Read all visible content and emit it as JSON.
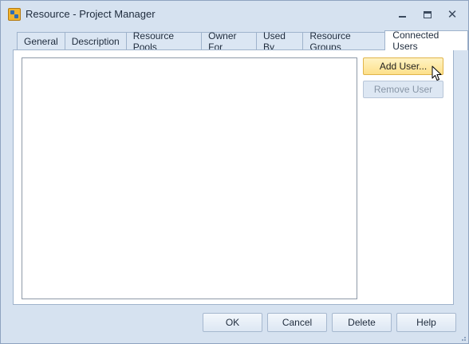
{
  "window": {
    "title": "Resource - Project Manager",
    "app_icon": "resource-app-icon",
    "controls": [
      "minimize-icon",
      "maximize-icon",
      "close-icon"
    ]
  },
  "tabs": [
    {
      "label": "General",
      "active": false
    },
    {
      "label": "Description",
      "active": false
    },
    {
      "label": "Resource Pools",
      "active": false
    },
    {
      "label": "Owner For",
      "active": false
    },
    {
      "label": "Used By",
      "active": false
    },
    {
      "label": "Resource Groups",
      "active": false
    },
    {
      "label": "Connected Users",
      "active": true
    }
  ],
  "connected_users": {
    "items": [],
    "add_user_label": "Add User...",
    "remove_user_label": "Remove User",
    "remove_user_enabled": false
  },
  "footer": {
    "ok_label": "OK",
    "cancel_label": "Cancel",
    "delete_label": "Delete",
    "help_label": "Help"
  },
  "colors": {
    "window_bg": "#d6e2f0",
    "add_button_hover": "#fde08a"
  }
}
